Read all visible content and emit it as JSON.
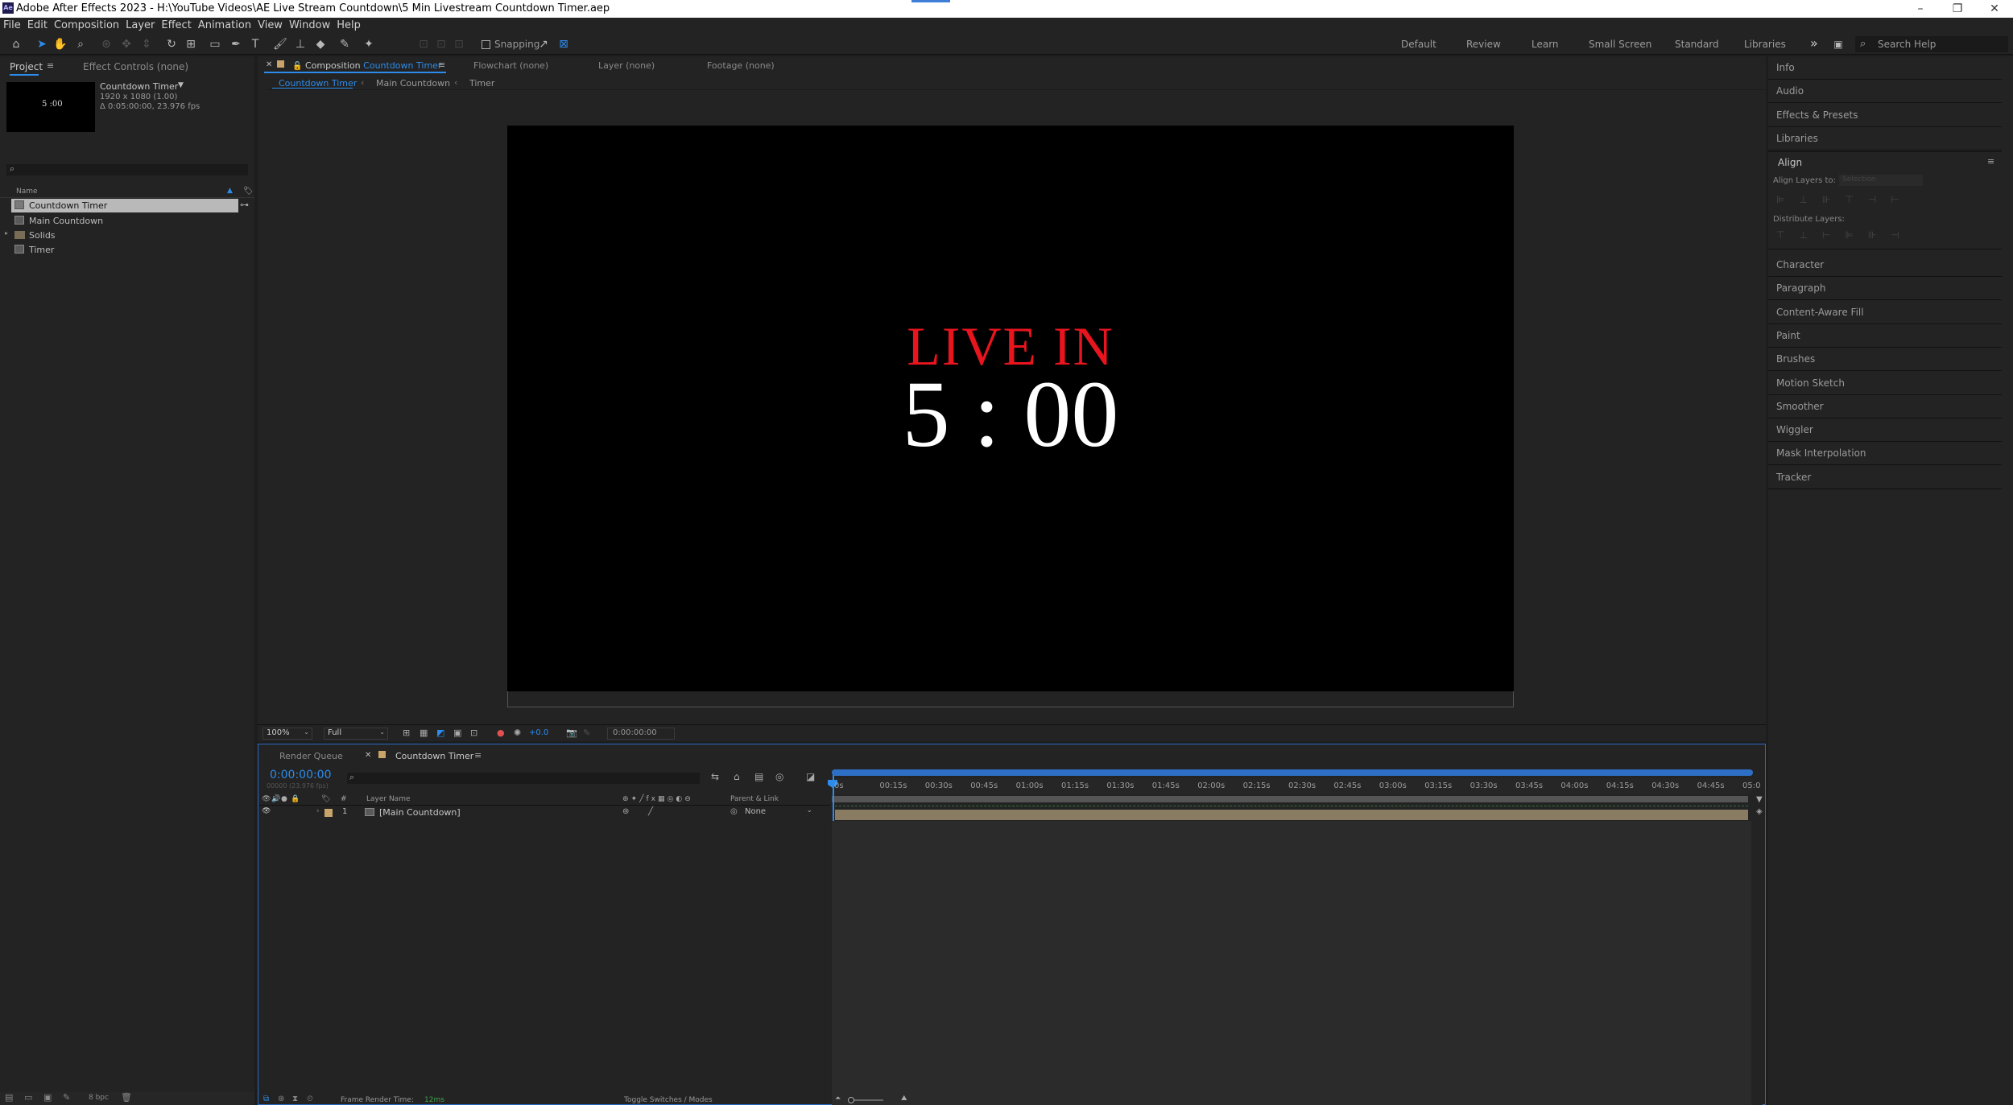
{
  "titlebar": {
    "title": "Adobe After Effects 2023 - H:\\YouTube Videos\\AE Live Stream Countdown\\5 Min Livestream Countdown Timer.aep",
    "logo": "Ae",
    "minimize": "–",
    "restore": "❐",
    "close": "✕"
  },
  "menu": [
    "File",
    "Edit",
    "Composition",
    "Layer",
    "Effect",
    "Animation",
    "View",
    "Window",
    "Help"
  ],
  "toolbar": {
    "snapping_label": "Snapping",
    "workspaces": [
      "Default",
      "Review",
      "Learn",
      "Small Screen",
      "Standard",
      "Libraries"
    ],
    "more": "»",
    "search_placeholder": "Search Help"
  },
  "project_panel": {
    "tab_project": "Project",
    "tab_effect_controls": "Effect Controls (none)",
    "preview_text": "5 :00",
    "comp_name": "Countdown Timer",
    "comp_dims": "1920 x 1080 (1.00)",
    "comp_duration": "Δ 0:05:00:00, 23.976 fps",
    "column_name": "Name",
    "items": [
      {
        "name": "Countdown Timer",
        "type": "comp",
        "selected": true
      },
      {
        "name": "Main Countdown",
        "type": "comp",
        "selected": false
      },
      {
        "name": "Solids",
        "type": "folder",
        "selected": false
      },
      {
        "name": "Timer",
        "type": "comp",
        "selected": false
      }
    ],
    "bpc": "8 bpc"
  },
  "viewer": {
    "tab_composition_prefix": "Composition",
    "tab_composition_name": "Countdown Timer",
    "tab_flowchart": "Flowchart (none)",
    "tab_layer": "Layer (none)",
    "tab_footage": "Footage (none)",
    "breadcrumbs": [
      "Countdown Timer",
      "Main Countdown",
      "Timer"
    ],
    "live_in": "LIVE IN",
    "timer": "5 : 00",
    "zoom": "100%",
    "resolution": "Full",
    "exposure": "+0.0",
    "timecode": "0:00:00:00",
    "live_color": "#e8141e"
  },
  "timeline": {
    "tab_render_queue": "Render Queue",
    "tab_comp": "Countdown Timer",
    "current_time": "0:00:00:00",
    "frames": "00000 (23.976 fps)",
    "col_layer_name": "Layer Name",
    "col_parent": "Parent & Link",
    "layers": [
      {
        "num": "1",
        "name": "[Main Countdown]",
        "parent": "None"
      }
    ],
    "ruler": [
      "0s",
      "00:15s",
      "00:30s",
      "00:45s",
      "01:00s",
      "01:15s",
      "01:30s",
      "01:45s",
      "02:00s",
      "02:15s",
      "02:30s",
      "02:45s",
      "03:00s",
      "03:15s",
      "03:30s",
      "03:45s",
      "04:00s",
      "04:15s",
      "04:30s",
      "04:45s",
      "05:0"
    ],
    "frame_render_label": "Frame Render Time:",
    "frame_render_value": "12ms",
    "toggle_switches": "Toggle Switches / Modes"
  },
  "right_panel": {
    "items_top": [
      "Info",
      "Audio",
      "Effects & Presets",
      "Libraries"
    ],
    "align_title": "Align",
    "align_to_label": "Align Layers to:",
    "align_to_value": "Selection",
    "distribute_label": "Distribute Layers:",
    "items_bottom": [
      "Character",
      "Paragraph",
      "Content-Aware Fill",
      "Paint",
      "Brushes",
      "Motion Sketch",
      "Smoother",
      "Wiggler",
      "Mask Interpolation",
      "Tracker"
    ]
  }
}
